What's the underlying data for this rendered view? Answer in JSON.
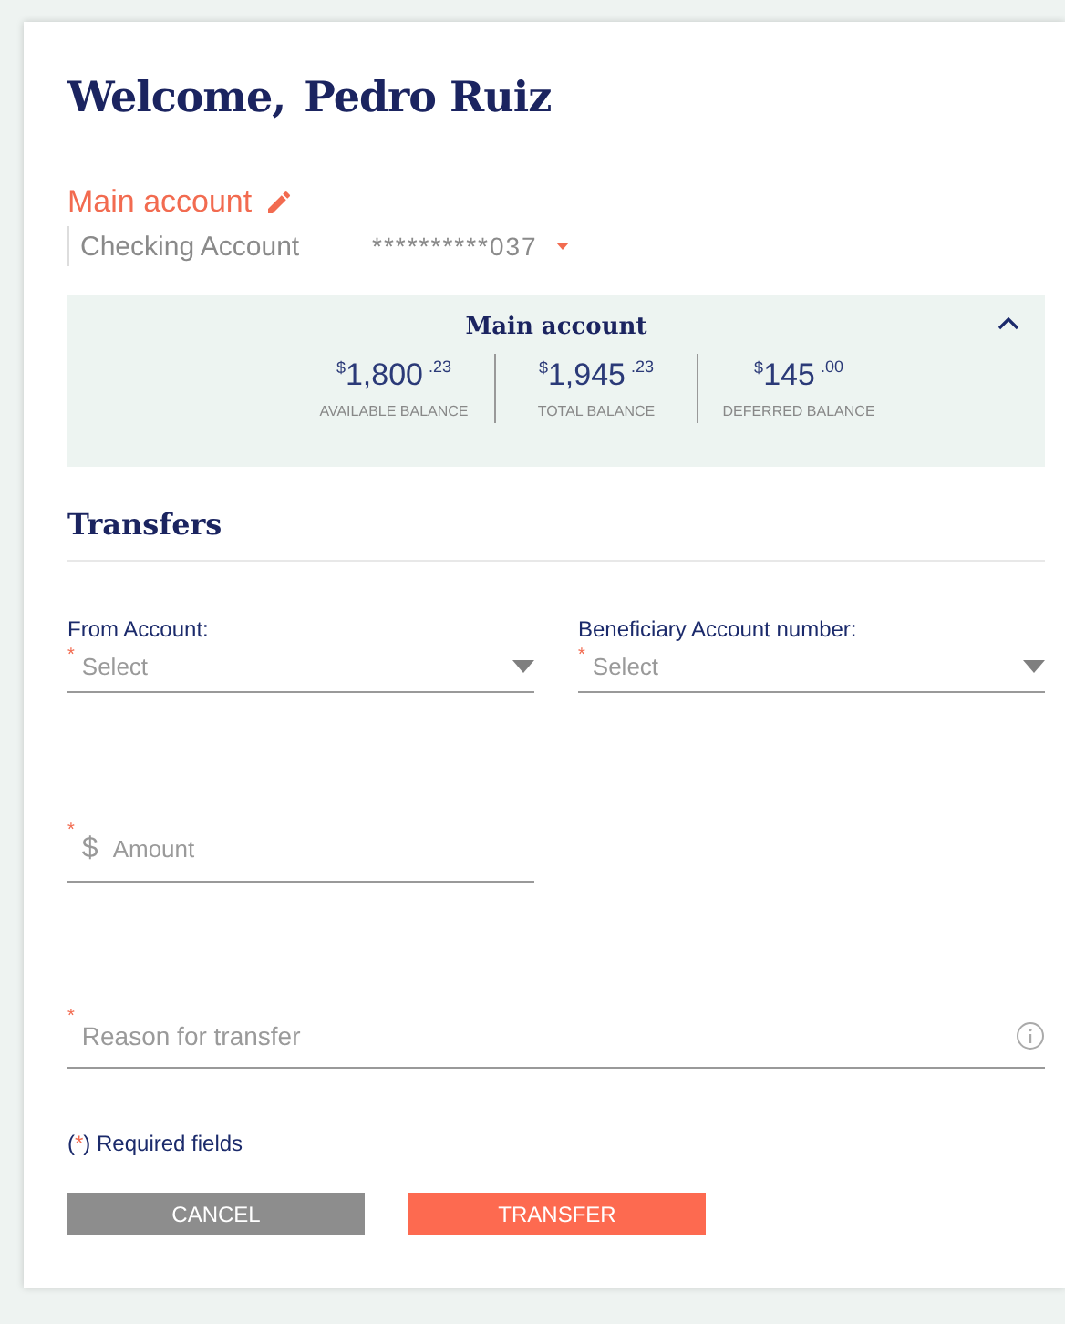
{
  "greeting": {
    "welcome": "Welcome,",
    "name": "Pedro Ruiz"
  },
  "account": {
    "label": "Main account",
    "type": "Checking Account",
    "number": "**********037"
  },
  "summary": {
    "title": "Main account",
    "expanded": true,
    "balances": [
      {
        "currency": "$",
        "whole": "1,800",
        "cents": ".23",
        "label": "AVAILABLE BALANCE"
      },
      {
        "currency": "$",
        "whole": "1,945",
        "cents": ".23",
        "label": "TOTAL BALANCE"
      },
      {
        "currency": "$",
        "whole": "145",
        "cents": ".00",
        "label": "DEFERRED BALANCE"
      }
    ]
  },
  "transfers": {
    "title": "Transfers",
    "selects": [
      {
        "label": "From Account:",
        "required_mark": "*",
        "placeholder": "Select"
      },
      {
        "label": "Beneficiary Account number:",
        "required_mark": "*",
        "placeholder": "Select"
      }
    ],
    "amount": {
      "required_mark": "*",
      "prefix": "$",
      "placeholder": "Amount"
    },
    "reason": {
      "required_mark": "*",
      "placeholder": "Reason for transfer"
    },
    "note": [
      {
        "kind": "plain",
        "text": "("
      },
      {
        "kind": "mark",
        "text": "*"
      },
      {
        "kind": "plain",
        "text": ") Required fields"
      }
    ],
    "buttons": [
      {
        "kind": "secondary",
        "label": "CANCEL"
      },
      {
        "kind": "primary",
        "label": "TRANSFER"
      }
    ]
  }
}
